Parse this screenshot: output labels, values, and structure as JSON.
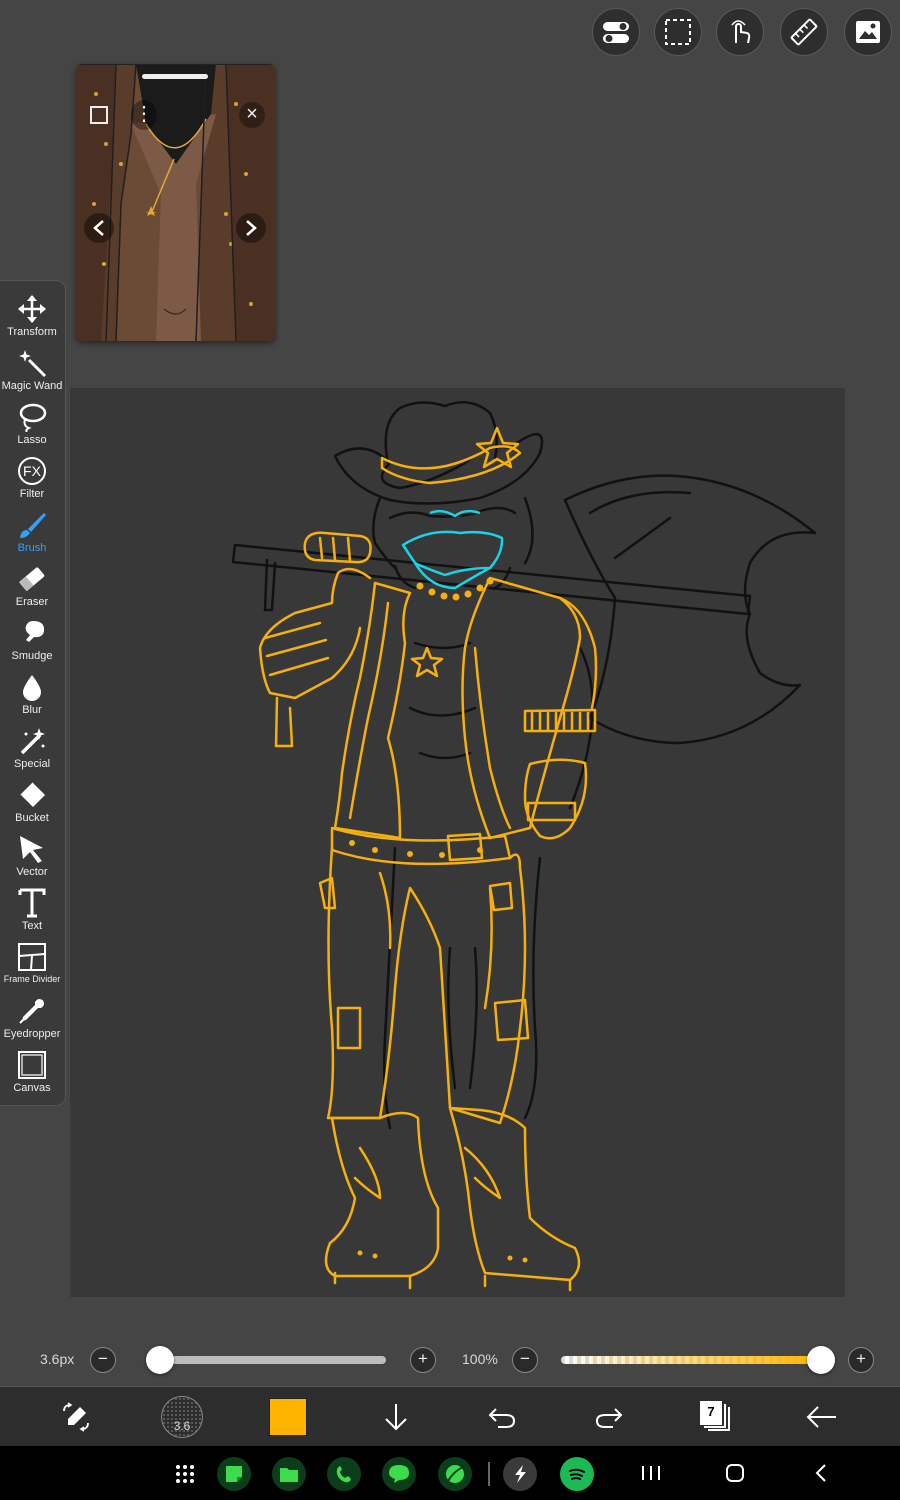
{
  "top_toolbar": {
    "buttons": [
      {
        "name": "toggle-settings-icon"
      },
      {
        "name": "selection-icon"
      },
      {
        "name": "touch-gesture-icon"
      },
      {
        "name": "ruler-icon"
      },
      {
        "name": "gallery-icon"
      }
    ]
  },
  "reference_window": {
    "drag_handle": "drag-handle-icon",
    "expand_icon": "expand-icon",
    "menu_icon": "more-vertical-icon",
    "close_icon": "close-icon",
    "prev_icon": "chevron-left-icon",
    "next_icon": "chevron-right-icon"
  },
  "tools": [
    {
      "label": "Transform",
      "icon": "move-arrows-icon"
    },
    {
      "label": "Magic Wand",
      "icon": "magic-wand-icon"
    },
    {
      "label": "Lasso",
      "icon": "lasso-icon"
    },
    {
      "label": "Filter",
      "icon": "fx-icon"
    },
    {
      "label": "Brush",
      "icon": "brush-icon",
      "active": true
    },
    {
      "label": "Eraser",
      "icon": "eraser-icon"
    },
    {
      "label": "Smudge",
      "icon": "smudge-icon"
    },
    {
      "label": "Blur",
      "icon": "drop-icon"
    },
    {
      "label": "Special",
      "icon": "special-wand-icon"
    },
    {
      "label": "Bucket",
      "icon": "bucket-icon"
    },
    {
      "label": "Vector",
      "icon": "vector-arrow-icon"
    },
    {
      "label": "Text",
      "icon": "text-icon"
    },
    {
      "label": "Frame Divider",
      "icon": "frame-divider-icon"
    },
    {
      "label": "Eyedropper",
      "icon": "eyedropper-icon"
    },
    {
      "label": "Canvas",
      "icon": "canvas-icon"
    }
  ],
  "sliders": {
    "size": {
      "value_text": "3.6px",
      "level": 0.0
    },
    "opacity": {
      "value_text": "100%",
      "level": 1.0
    }
  },
  "bottom_bar": {
    "brush_size_text": "3.6",
    "current_color": "#FFB400",
    "layer_count": "7"
  },
  "colors": {
    "accent": "#34A0FF",
    "line_gold": "#F5B00E",
    "line_cyan": "#19D3E6",
    "ui_bg": "#454545",
    "canvas_bg": "#383838"
  },
  "system_nav": {
    "apps": [
      {
        "name": "app-drawer-icon"
      },
      {
        "name": "notes-app-icon",
        "color": "#23b24a"
      },
      {
        "name": "files-app-icon",
        "color": "#23b24a"
      },
      {
        "name": "phone-app-icon",
        "color": "#23b24a"
      },
      {
        "name": "messages-app-icon",
        "color": "#23b24a"
      },
      {
        "name": "browser-app-icon",
        "color": "#23b24a"
      },
      {
        "name": "ibis-paint-app-icon",
        "color": "#444444"
      },
      {
        "name": "spotify-app-icon",
        "color": "#1db954"
      }
    ]
  }
}
